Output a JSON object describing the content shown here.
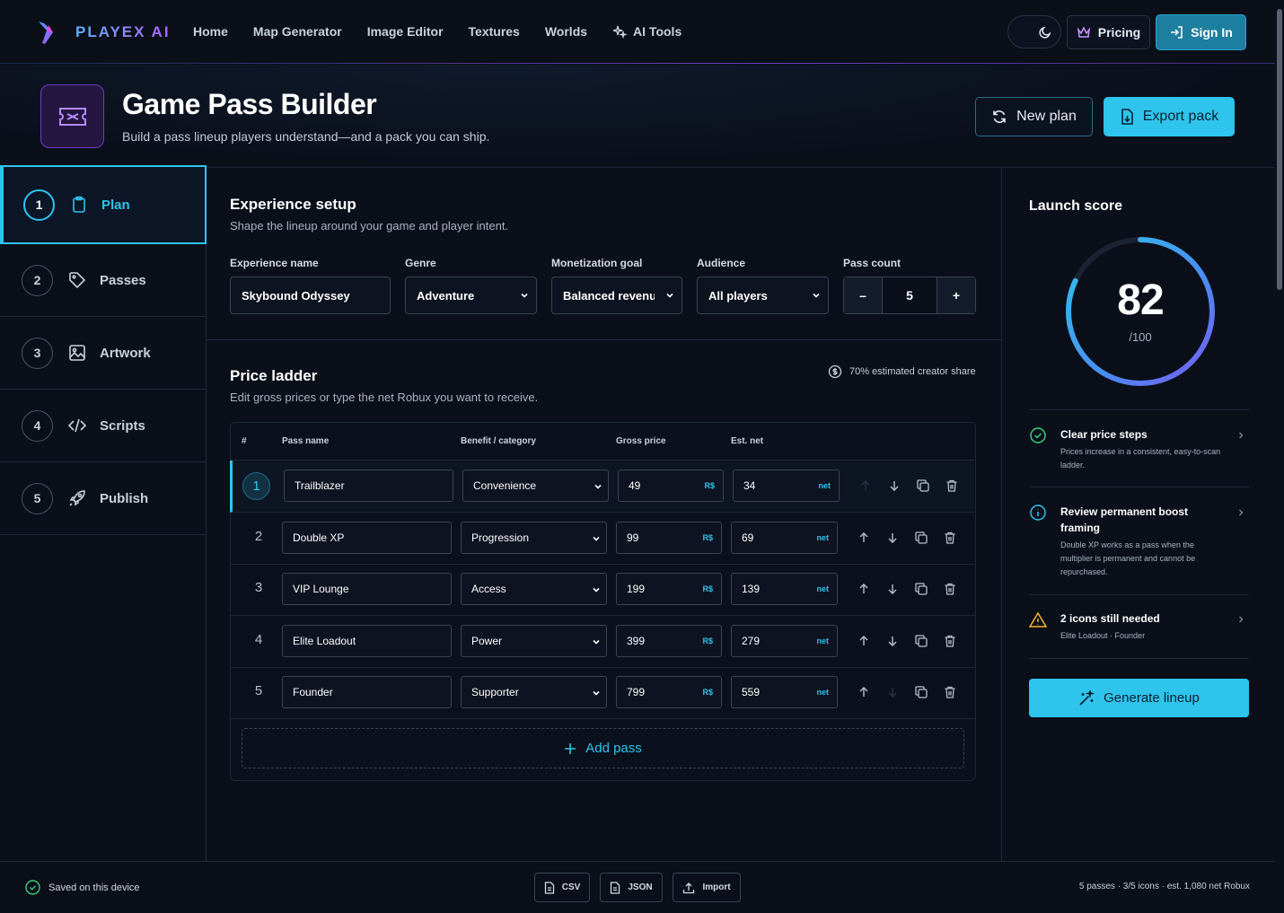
{
  "brand": "PLAYEX AI",
  "nav": {
    "links": [
      "Home",
      "Map Generator",
      "Image Editor",
      "Textures",
      "Worlds",
      "AI Tools"
    ],
    "pricing": "Pricing",
    "sign_in": "Sign In"
  },
  "header": {
    "title": "Game Pass Builder",
    "subtitle": "Build a pass lineup players understand—and a pack you can ship.",
    "new_plan": "New plan",
    "export_pack": "Export pack"
  },
  "sidebar": {
    "steps": [
      {
        "num": "1",
        "label": "Plan",
        "icon": "clipboard-icon"
      },
      {
        "num": "2",
        "label": "Passes",
        "icon": "tag-icon"
      },
      {
        "num": "3",
        "label": "Artwork",
        "icon": "image-icon"
      },
      {
        "num": "4",
        "label": "Scripts",
        "icon": "code-icon"
      },
      {
        "num": "5",
        "label": "Publish",
        "icon": "rocket-icon"
      }
    ]
  },
  "experience": {
    "title": "Experience setup",
    "subtitle": "Shape the lineup around your game and player intent.",
    "fields": {
      "name_label": "Experience name",
      "name_value": "Skybound Odyssey",
      "genre_label": "Genre",
      "genre_value": "Adventure",
      "goal_label": "Monetization goal",
      "goal_value": "Balanced revenu",
      "audience_label": "Audience",
      "audience_value": "All players",
      "count_label": "Pass count",
      "count_value": "5",
      "minus": "–",
      "plus": "+"
    }
  },
  "ladder": {
    "title": "Price ladder",
    "subtitle": "Edit gross prices or type the net Robux you want to receive.",
    "creator_share": "70% estimated creator share",
    "headers": [
      "#",
      "Pass name",
      "Benefit / category",
      "Gross price",
      "Est. net"
    ],
    "gross_unit": "R$",
    "net_unit": "net",
    "rows": [
      {
        "num": "1",
        "name": "Trailblazer",
        "category": "Convenience",
        "gross": "49",
        "net": "34"
      },
      {
        "num": "2",
        "name": "Double XP",
        "category": "Progression",
        "gross": "99",
        "net": "69"
      },
      {
        "num": "3",
        "name": "VIP Lounge",
        "category": "Access",
        "gross": "199",
        "net": "139"
      },
      {
        "num": "4",
        "name": "Elite Loadout",
        "category": "Power",
        "gross": "399",
        "net": "279"
      },
      {
        "num": "5",
        "name": "Founder",
        "category": "Supporter",
        "gross": "799",
        "net": "559"
      }
    ],
    "add_pass": "Add pass"
  },
  "launch": {
    "title": "Launch score",
    "score": "82",
    "denominator": "/100",
    "score_fraction": 0.82,
    "checks": [
      {
        "title": "Clear price steps",
        "desc": "Prices increase in a consistent, easy-to-scan ladder.",
        "status": "ok"
      },
      {
        "title": "Review permanent boost framing",
        "desc": "Double XP works as a pass when the multiplier is permanent and cannot be repurchased.",
        "status": "info"
      },
      {
        "title": "2 icons still needed",
        "desc": "Elite Loadout · Founder",
        "status": "warn"
      }
    ],
    "generate": "Generate lineup"
  },
  "footer": {
    "saved": "Saved on this device",
    "csv": "CSV",
    "json": "JSON",
    "import": "Import",
    "stats": "5 passes · 3/5 icons · est. 1,080 net Robux"
  },
  "colors": {
    "accent": "#2ec4ec",
    "background": "#0a0f1a",
    "brand_purple": "#6b3fc3",
    "success": "#3bd17a",
    "warning": "#f5b62b",
    "info": "#2ec4ec"
  }
}
